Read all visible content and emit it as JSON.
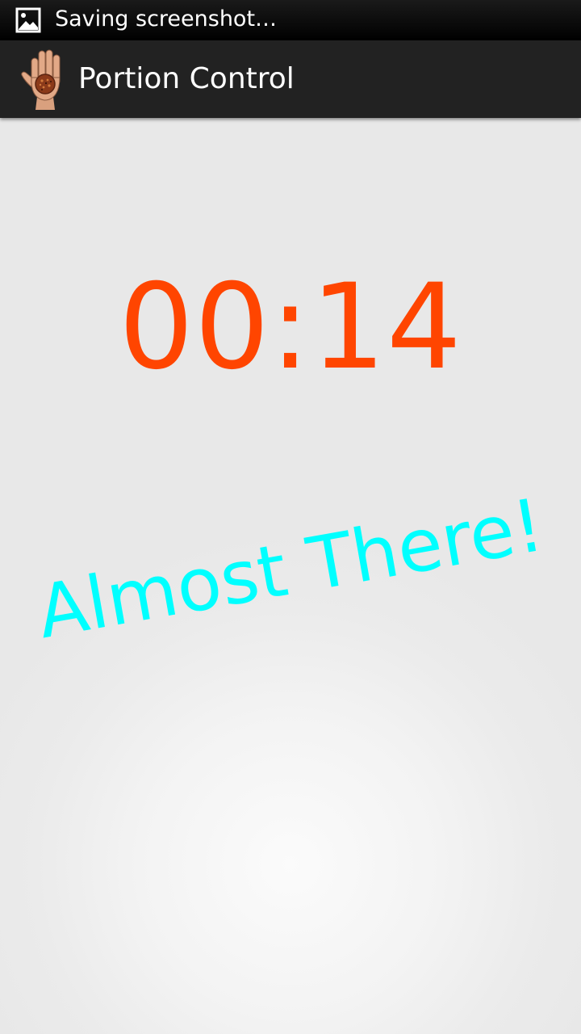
{
  "status_bar": {
    "notification_text": "Saving screenshot…",
    "notification_icon": "image-icon"
  },
  "action_bar": {
    "app_icon": "hand-with-cookie-icon",
    "title": "Portion Control"
  },
  "main": {
    "timer_text": "00:14",
    "message": "Almost There!"
  },
  "colors": {
    "timer": "#ff4500",
    "message": "#00ffff",
    "action_bar": "#222222",
    "status_bar": "#000000"
  }
}
